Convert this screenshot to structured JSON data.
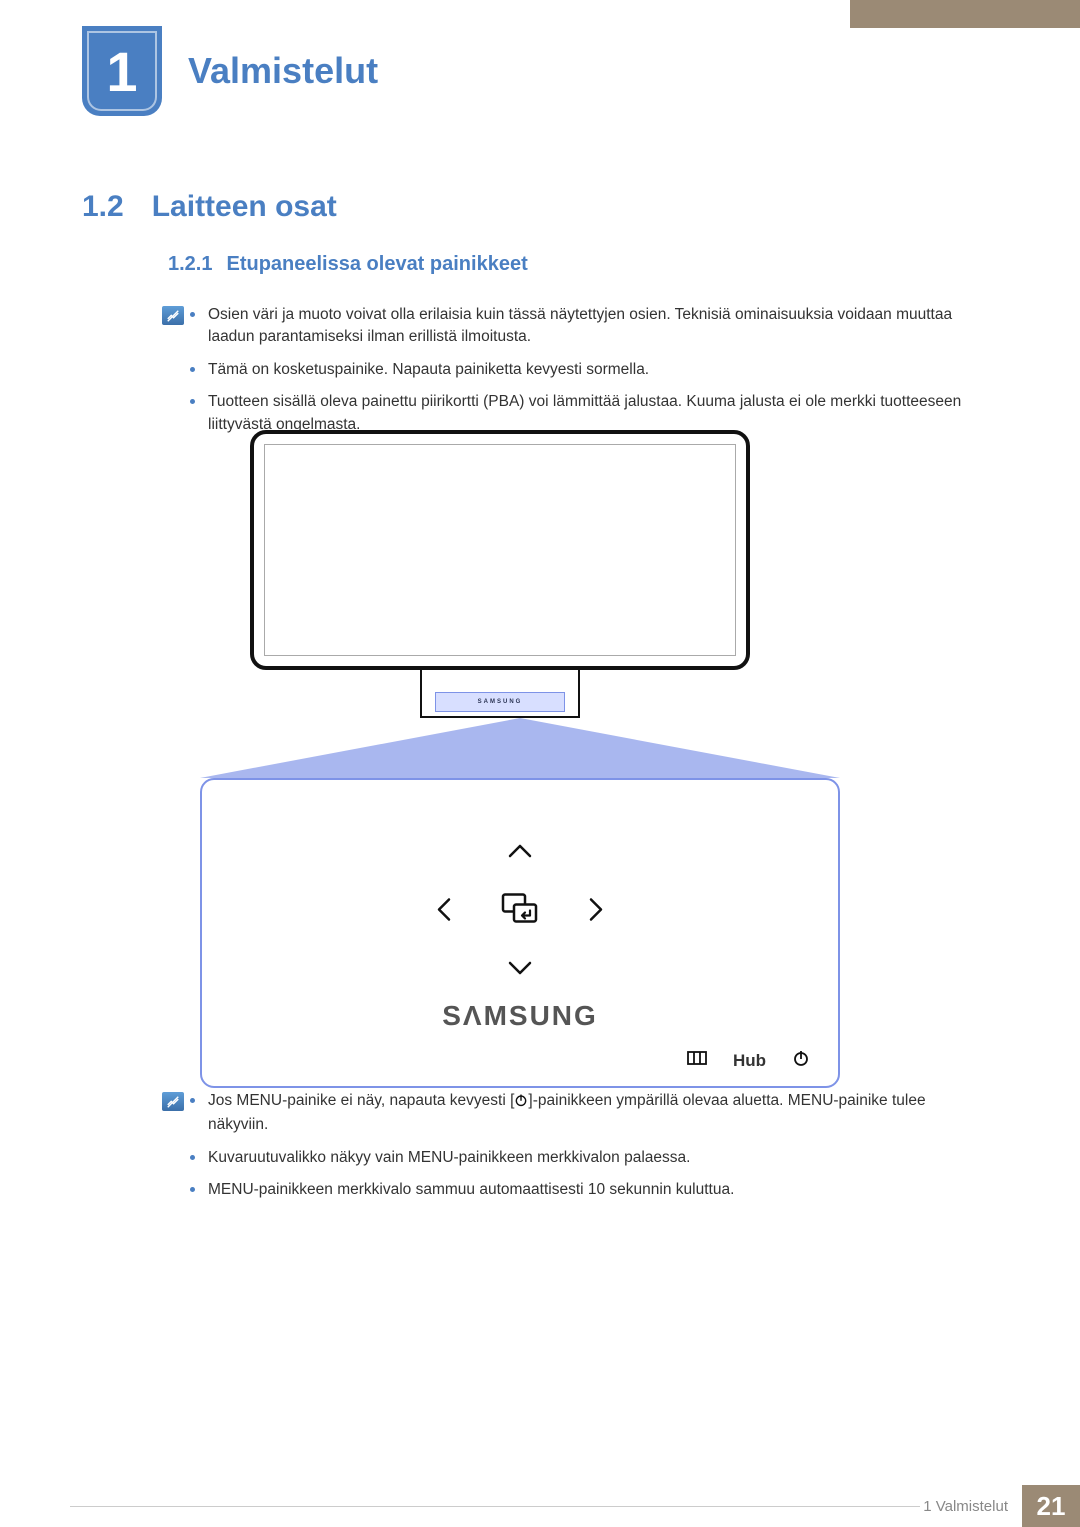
{
  "chapter": {
    "number": "1",
    "title": "Valmistelut"
  },
  "section": {
    "number": "1.2",
    "title": "Laitteen osat"
  },
  "subsection": {
    "number": "1.2.1",
    "title": "Etupaneelissa olevat painikkeet"
  },
  "notes1": {
    "items": [
      "Osien väri ja muoto voivat olla erilaisia kuin tässä näytettyjen osien. Teknisiä ominaisuuksia voidaan muuttaa laadun parantamiseksi ilman erillistä ilmoitusta.",
      "Tämä on kosketuspainike. Napauta painiketta kevyesti sormella.",
      "Tuotteen sisällä oleva painettu piirikortti (PBA) voi lämmittää jalustaa. Kuuma jalusta ei ole merkki tuotteeseen liittyvästä ongelmasta."
    ]
  },
  "figure": {
    "baseLabel": "SAMSUNG",
    "brand": "SΛMSUNG",
    "hubLabel": "Hub"
  },
  "notes2": {
    "item1_pre": "Jos MENU-painike ei näy, napauta kevyesti [",
    "item1_post": "]-painikkeen ympärillä olevaa aluetta. MENU-painike tulee näkyviin.",
    "item2": "Kuvaruutuvalikko näkyy vain MENU-painikkeen merkkivalon palaessa.",
    "item3": "MENU-painikkeen merkkivalo sammuu automaattisesti 10 sekunnin kuluttua."
  },
  "footer": {
    "label": "1 Valmistelut",
    "page": "21"
  }
}
